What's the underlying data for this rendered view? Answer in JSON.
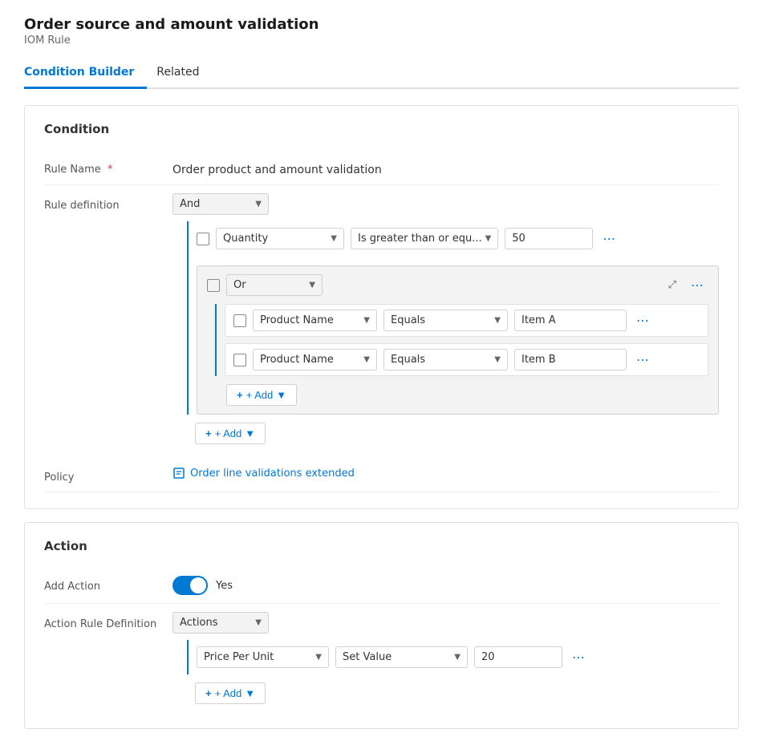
{
  "page": {
    "title": "Order source and amount validation",
    "subtitle": "IOM Rule"
  },
  "tabs": [
    {
      "id": "condition-builder",
      "label": "Condition Builder",
      "active": true
    },
    {
      "id": "related",
      "label": "Related",
      "active": false
    }
  ],
  "condition_section": {
    "title": "Condition",
    "rule_name_label": "Rule Name",
    "rule_name_required": "*",
    "rule_name_value": "Order product and amount validation",
    "rule_definition_label": "Rule definition",
    "policy_label": "Policy",
    "policy_link_text": "Order line validations extended",
    "and_operator": "And",
    "or_operator": "Or",
    "quantity_field": "Quantity",
    "quantity_operator": "Is greater than or equ...",
    "quantity_value": "50",
    "product_name_field": "Product Name",
    "equals_operator": "Equals",
    "item_a_value": "Item A",
    "item_b_value": "Item B",
    "add_label": "+ Add",
    "add_outer_label": "+ Add"
  },
  "action_section": {
    "title": "Action",
    "add_action_label": "Add Action",
    "add_action_toggle": "Yes",
    "action_rule_def_label": "Action Rule Definition",
    "actions_operator": "Actions",
    "price_per_unit_field": "Price Per Unit",
    "set_value_operator": "Set Value",
    "price_value": "20",
    "add_label": "+ Add"
  }
}
